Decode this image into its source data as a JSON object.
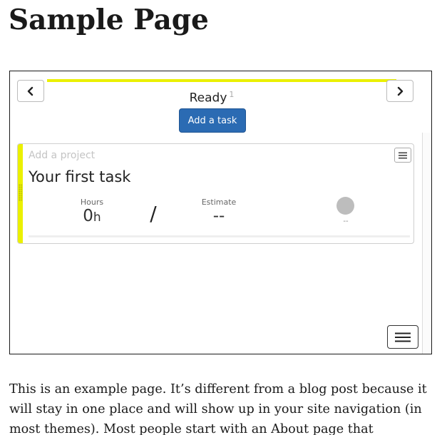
{
  "page": {
    "title": "Sample Page",
    "body_text": "This is an example page. It’s different from a blog post because it will stay in one place and will show up in your site navigation (in most themes). Most people start with an About page that"
  },
  "widget": {
    "header": {
      "status_label": "Ready",
      "status_count": "1",
      "prev_icon": "chevron-left-icon",
      "next_icon": "chevron-right-icon",
      "accent_color": "#ebf000"
    },
    "add_task_label": "Add a task",
    "task": {
      "project_placeholder": "Add a project",
      "title": "Your first task",
      "hours_label": "Hours",
      "hours_value": "0",
      "hours_unit": "h",
      "separator": "/",
      "estimate_label": "Estimate",
      "estimate_value": "--",
      "assignee_caption": "--",
      "menu_icon": "hamburger-icon"
    },
    "main_menu_icon": "hamburger-icon",
    "colors": {
      "primary_button": "#2b6bb3",
      "accent": "#ebf000"
    }
  }
}
